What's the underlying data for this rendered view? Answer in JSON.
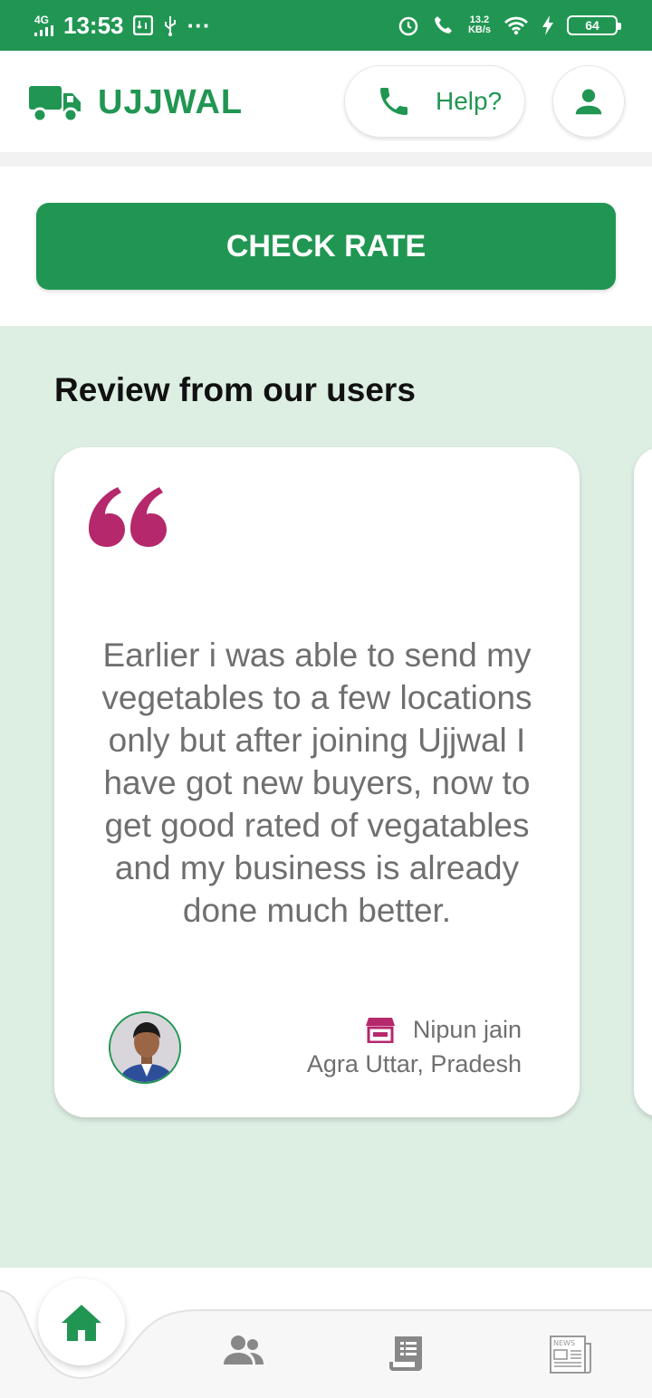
{
  "status_bar": {
    "network": "4G",
    "time": "13:53",
    "speed_value": "13.2",
    "speed_unit": "KB/s",
    "battery": "64"
  },
  "header": {
    "brand_name": "UJJWAL",
    "help_label": "Help?"
  },
  "actions": {
    "check_rate_label": "CHECK RATE"
  },
  "reviews": {
    "title": "Review from our users",
    "items": [
      {
        "text": "Earlier i was able to send my vegetables to a few locations only but after joining Ujjwal I have got new buyers, now to get good rated of vegatables and my business is already done much better.",
        "author_name": "Nipun jain",
        "author_location": "Agra Uttar, Pradesh"
      }
    ]
  },
  "bottom_nav": {
    "items": [
      "home-icon",
      "users-icon",
      "receipt-icon",
      "news-icon"
    ],
    "active": "home-icon"
  },
  "colors": {
    "brand_green": "#219653",
    "quote_magenta": "#b5286c",
    "section_bg": "#ddeee3",
    "text_gray": "#6f6f6f",
    "icon_gray": "#888888"
  }
}
